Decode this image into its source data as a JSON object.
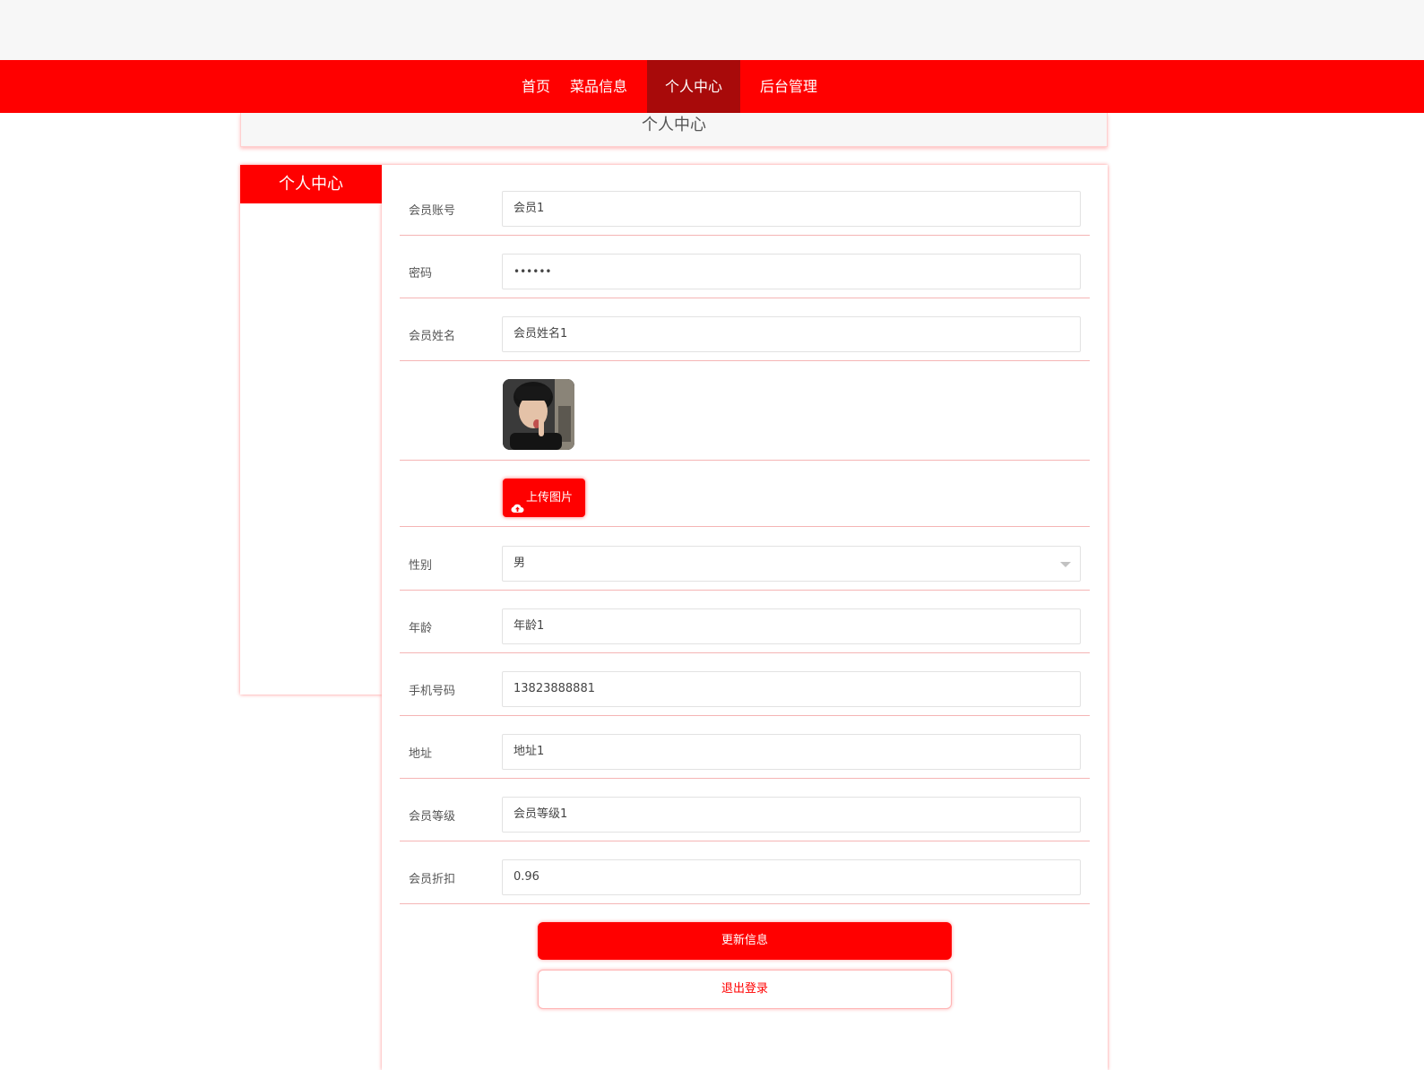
{
  "nav": {
    "items": [
      {
        "label": "首页"
      },
      {
        "label": "菜品信息"
      },
      {
        "label": "个人中心"
      },
      {
        "label": "后台管理"
      }
    ],
    "active_index": 2
  },
  "page_title": "个人中心",
  "sidebar": {
    "title": "个人中心"
  },
  "form": {
    "account": {
      "label": "会员账号",
      "value": "会员1"
    },
    "password": {
      "label": "密码",
      "value": "••••••"
    },
    "name": {
      "label": "会员姓名",
      "value": "会员姓名1"
    },
    "upload_label": "上传图片",
    "gender": {
      "label": "性别",
      "value": "男"
    },
    "age": {
      "label": "年龄",
      "value": "年龄1"
    },
    "phone": {
      "label": "手机号码",
      "value": "13823888881"
    },
    "address": {
      "label": "地址",
      "value": "地址1"
    },
    "level": {
      "label": "会员等级",
      "value": "会员等级1"
    },
    "discount": {
      "label": "会员折扣",
      "value": "0.96"
    }
  },
  "actions": {
    "update_label": "更新信息",
    "logout_label": "退出登录"
  },
  "colors": {
    "accent": "#ff0000",
    "nav_active": "#a80a0a",
    "divider": "#f5b5b5"
  }
}
